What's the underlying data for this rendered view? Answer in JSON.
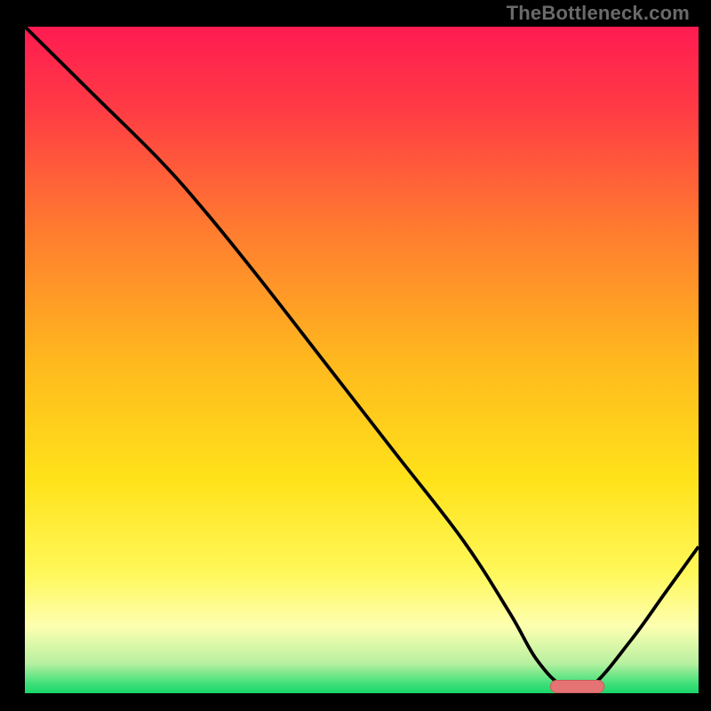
{
  "watermark": "TheBottleneck.com",
  "colors": {
    "background": "#000000",
    "curve": "#000000",
    "marker": "#e57373",
    "marker_outline": "#c75d5d"
  },
  "chart_data": {
    "type": "line",
    "title": "",
    "xlabel": "",
    "ylabel": "",
    "xlim": [
      0,
      100
    ],
    "ylim": [
      0,
      100
    ],
    "grid": false,
    "legend": false,
    "background_gradient": [
      {
        "stop": 0.0,
        "color": "#ff1b51"
      },
      {
        "stop": 0.12,
        "color": "#ff3a45"
      },
      {
        "stop": 0.3,
        "color": "#ff7a30"
      },
      {
        "stop": 0.5,
        "color": "#ffb81e"
      },
      {
        "stop": 0.68,
        "color": "#ffe21a"
      },
      {
        "stop": 0.82,
        "color": "#fff85a"
      },
      {
        "stop": 0.9,
        "color": "#fdffb0"
      },
      {
        "stop": 0.955,
        "color": "#b8f0a0"
      },
      {
        "stop": 0.985,
        "color": "#42e07a"
      },
      {
        "stop": 1.0,
        "color": "#18d66a"
      }
    ],
    "series": [
      {
        "name": "curve",
        "x": [
          0,
          10,
          20,
          27,
          35,
          45,
          55,
          65,
          72,
          76,
          80,
          84,
          90,
          95,
          100
        ],
        "y": [
          100,
          90,
          80,
          72,
          62,
          49,
          36,
          23,
          12,
          5,
          1,
          1,
          8,
          15,
          22
        ]
      }
    ],
    "annotations": [
      {
        "type": "flat-segment-marker",
        "x_start": 78,
        "x_end": 86,
        "y": 1
      }
    ]
  }
}
